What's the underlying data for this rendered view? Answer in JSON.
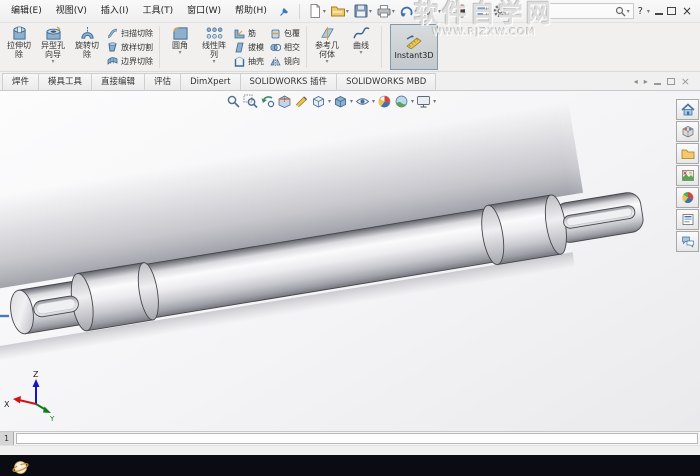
{
  "titlebar": {
    "menus": [
      "编辑(E)",
      "视图(V)",
      "插入(I)",
      "工具(T)",
      "窗口(W)",
      "帮助(H)"
    ]
  },
  "icons": {
    "caret": "▾",
    "win_prev": "◂",
    "win_next": "▸",
    "help": "?",
    "close": "×"
  },
  "quick_toolbar_icons": [
    "new-file",
    "open-file",
    "save",
    "print",
    "undo",
    "select-arrow",
    "rebuild-traffic-light",
    "file-properties",
    "options-gear"
  ],
  "watermark": {
    "line1": "软件自学网",
    "line2": "WWW.RJZXW.COM"
  },
  "ribbon": {
    "extrude_cut_l1": "拉伸切",
    "extrude_cut_l2": "除",
    "hole_wizard_l1": "异型孔",
    "hole_wizard_l2": "向导",
    "revolve_cut_l1": "旋转切",
    "revolve_cut_l2": "除",
    "sweep_cut": "扫描切除",
    "loft_cut": "放样切割",
    "boundary_cut": "边界切除",
    "fillet": "圆角",
    "pattern_l1": "线性阵",
    "pattern_l2": "列",
    "rib": "筋",
    "draft": "拔模",
    "shell": "抽壳",
    "wrap": "包覆",
    "intersect": "相交",
    "mirror": "镜向",
    "refgeo_l1": "参考几",
    "refgeo_l2": "何体",
    "curves": "曲线",
    "instant3d": "Instant3D"
  },
  "tabs": [
    "焊件",
    "模具工具",
    "直接编辑",
    "评估",
    "DimXpert",
    "SOLIDWORKS 插件",
    "SOLIDWORKS MBD"
  ],
  "headsup_icons": [
    "zoom-to-fit",
    "zoom-to-area",
    "previous-view",
    "section-view",
    "sketch-annotation",
    "view-orientation",
    "display-style",
    "hide-show-items",
    "edit-appearance",
    "apply-scene",
    "view-settings"
  ],
  "taskpane_icons": [
    "solidworks-resources-home",
    "design-library",
    "file-explorer",
    "view-palette",
    "appearances-scenes",
    "custom-properties",
    "solidworks-forum"
  ],
  "viewport": {
    "triad_x": "X",
    "triad_y": "Y",
    "triad_z": "Z",
    "model": "stepped-shaft-with-keyways"
  },
  "statusbar": {
    "page": "1"
  }
}
